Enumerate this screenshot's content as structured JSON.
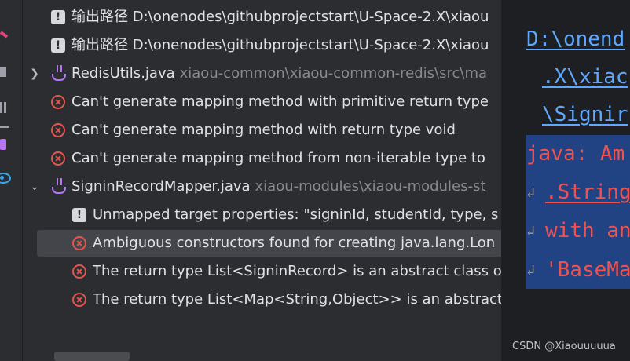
{
  "tree": {
    "rows": [
      {
        "icon": "warning-icon",
        "text": "输出路径 D:\\onenodes\\githubprojectstart\\U-Space-2.X\\xiaou"
      },
      {
        "icon": "warning-icon",
        "text": "输出路径 D:\\onenodes\\githubprojectstart\\U-Space-2.X\\xiaou"
      },
      {
        "icon": "java-file-icon",
        "file": "RedisUtils.java",
        "path": "xiaou-common\\xiaou-common-redis\\src\\ma"
      },
      {
        "icon": "error-icon",
        "text": "Can't generate mapping method with primitive return type"
      },
      {
        "icon": "error-icon",
        "text": "Can't generate mapping method with return type void"
      },
      {
        "icon": "error-icon",
        "text": "Can't generate mapping method from non-iterable type to"
      },
      {
        "icon": "java-file-icon",
        "file": "SigninRecordMapper.java",
        "path": "xiaou-modules\\xiaou-modules-st"
      },
      {
        "icon": "warning-icon",
        "text": "Unmapped target properties: \"signinId, studentId, type, s"
      },
      {
        "icon": "error-icon",
        "text": "Ambiguous constructors found for creating java.lang.Lon"
      },
      {
        "icon": "error-icon",
        "text": "The return type List<SigninRecord> is an abstract class o"
      },
      {
        "icon": "error-icon",
        "text": "The return type List<Map<String,Object>> is an abstract"
      }
    ]
  },
  "editor": {
    "lines": [
      {
        "text": "D:\\onend",
        "style": "link"
      },
      {
        "text": ".X\\xiac",
        "style": "link"
      },
      {
        "text": "\\Signir",
        "style": "link"
      },
      {
        "text": "java: Am",
        "style": "error"
      },
      {
        "text": ".String",
        "style": "error-link"
      },
      {
        "text": "with an",
        "style": "error"
      },
      {
        "text": "'BaseMa",
        "style": "error"
      }
    ],
    "wrap_mark": "↲"
  },
  "watermark": "CSDN @Xiaouuuuua",
  "colors": {
    "error": "#e5554f",
    "warning": "#d6d8dc",
    "java": "#b676f2",
    "link": "#5ea8ff",
    "selection": "#43454a",
    "error_block": "#214283"
  }
}
